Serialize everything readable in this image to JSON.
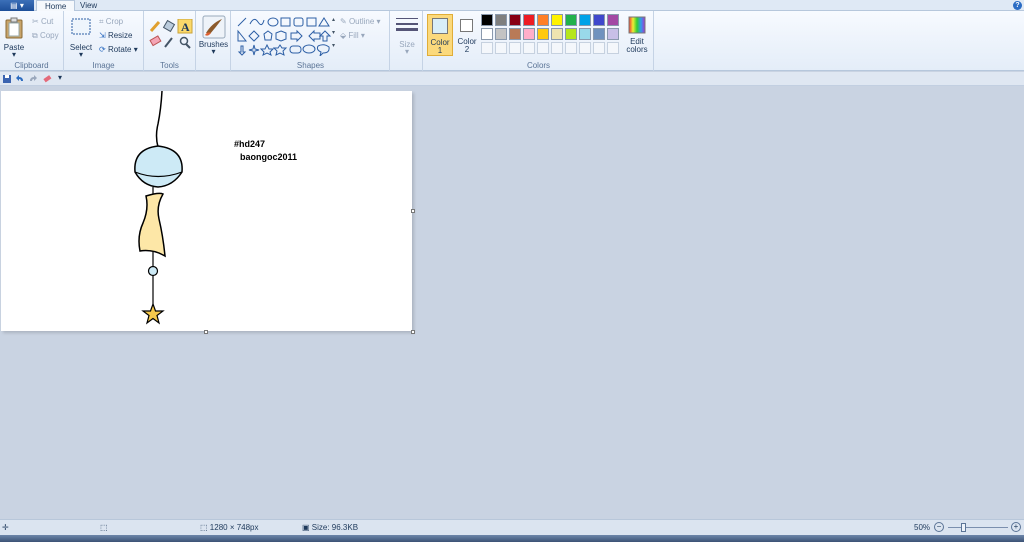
{
  "tabs": {
    "home": "Home",
    "view": "View"
  },
  "ribbon": {
    "clipboard": {
      "label": "Clipboard",
      "paste": "Paste",
      "cut": "Cut",
      "copy": "Copy"
    },
    "image": {
      "label": "Image",
      "select": "Select",
      "crop": "Crop",
      "resize": "Resize",
      "rotate": "Rotate"
    },
    "tools": {
      "label": "Tools"
    },
    "brushes": {
      "label": "Brushes"
    },
    "shapes": {
      "label": "Shapes",
      "outline": "Outline",
      "fill": "Fill"
    },
    "size": {
      "label": "Size"
    },
    "colors": {
      "label": "Colors",
      "color1": "Color",
      "color1_num": "1",
      "color2": "Color",
      "color2_num": "2",
      "edit": "Edit",
      "edit2": "colors",
      "color1_value": "#d8eef8",
      "color2_value": "#ffffff",
      "palette_row1": [
        "#000000",
        "#7f7f7f",
        "#880015",
        "#ed1c24",
        "#ff7f27",
        "#fff200",
        "#22b14c",
        "#00a2e8",
        "#3f48cc",
        "#a349a4"
      ],
      "palette_row2": [
        "#ffffff",
        "#c3c3c3",
        "#b97a57",
        "#ffaec9",
        "#ffc90e",
        "#efe4b0",
        "#b5e61d",
        "#99d9ea",
        "#7092be",
        "#c8bfe7"
      ]
    }
  },
  "canvas": {
    "text1": "#hd247",
    "text2": "baongoc2011"
  },
  "status": {
    "dimensions": "1280 × 748px",
    "size": "Size: 96.3KB",
    "zoom": "50%"
  }
}
